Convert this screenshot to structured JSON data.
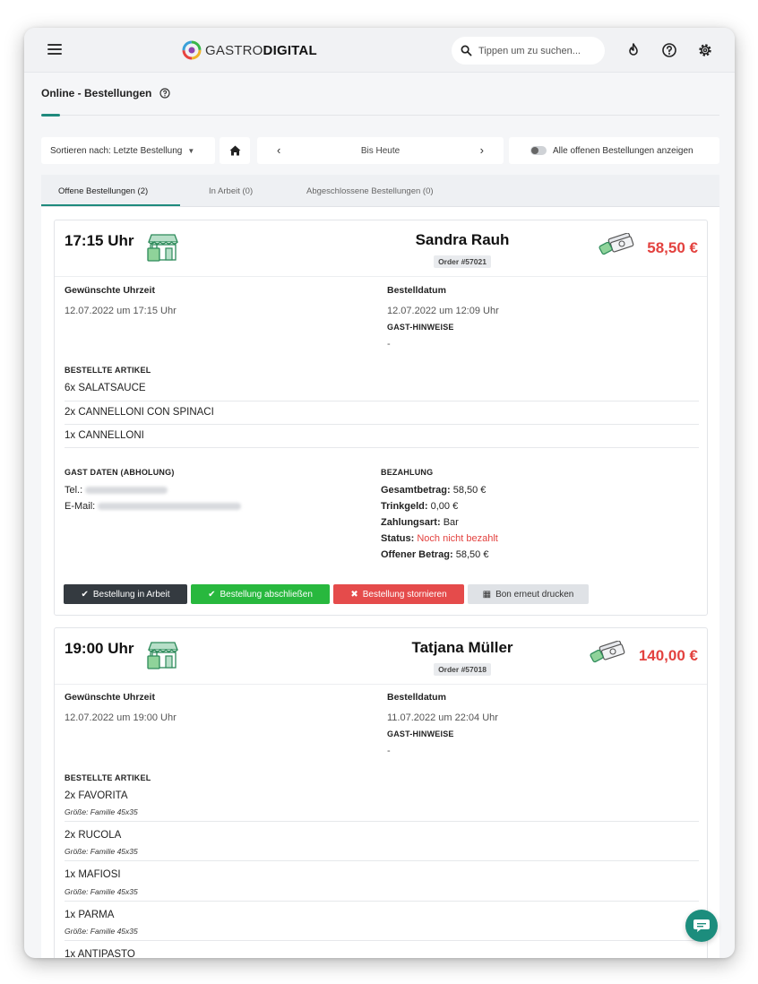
{
  "brand": {
    "name_light": "GASTRO",
    "name_bold": "DIGITAL"
  },
  "search": {
    "placeholder": "Tippen um zu suchen..."
  },
  "page": {
    "title": "Online - Bestellungen"
  },
  "filters": {
    "sort_label": "Sortieren nach: Letzte Bestellung",
    "date_label": "Bis Heute",
    "toggle_label": "Alle offenen Bestellungen anzeigen"
  },
  "tabs": [
    {
      "label": "Offene Bestellungen (2)",
      "active": true
    },
    {
      "label": "In Arbeit (0)",
      "active": false
    },
    {
      "label": "Abgeschlossene Bestellungen (0)",
      "active": false
    }
  ],
  "labels": {
    "wish_time": "Gewünschte Uhrzeit",
    "order_date": "Bestelldatum",
    "guest_notes": "GAST-HINWEISE",
    "ordered_items": "BESTELLTE ARTIKEL",
    "guest_data": "GAST DATEN (ABHOLUNG)",
    "payment": "BEZAHLUNG",
    "tel": "Tel.:",
    "email": "E-Mail:",
    "total": "Gesamtbetrag:",
    "tip": "Trinkgeld:",
    "pay_type": "Zahlungsart:",
    "status": "Status:",
    "open_amount": "Offener Betrag:"
  },
  "actions": {
    "in_progress": "Bestellung in Arbeit",
    "complete": "Bestellung abschließen",
    "cancel": "Bestellung stornieren",
    "reprint": "Bon erneut drucken"
  },
  "orders": [
    {
      "time": "17:15 Uhr",
      "customer": "Sandra Rauh",
      "order_no": "Order #57021",
      "price": "58,50 €",
      "wish_time": "12.07.2022 um 17:15 Uhr",
      "order_date": "12.07.2022 um 12:09 Uhr",
      "notes": "-",
      "items": [
        {
          "name": "6x SALATSAUCE"
        },
        {
          "name": "2x CANNELLONI CON SPINACI"
        },
        {
          "name": "1x CANNELLONI"
        }
      ],
      "payment": {
        "total": "58,50 €",
        "tip": "0,00 €",
        "type": "Bar",
        "status": "Noch nicht bezahlt",
        "open": "58,50 €"
      }
    },
    {
      "time": "19:00 Uhr",
      "customer": "Tatjana Müller",
      "order_no": "Order #57018",
      "price": "140,00 €",
      "wish_time": "12.07.2022 um 19:00 Uhr",
      "order_date": "11.07.2022 um 22:04 Uhr",
      "notes": "-",
      "items": [
        {
          "name": "2x FAVORITA",
          "size": "Größe: Familie 45x35"
        },
        {
          "name": "2x RUCOLA",
          "size": "Größe: Familie 45x35"
        },
        {
          "name": "1x MAFIOSI",
          "size": "Größe: Familie 45x35"
        },
        {
          "name": "1x PARMA",
          "size": "Größe: Familie 45x35"
        },
        {
          "name": "1x ANTIPASTO"
        }
      ]
    }
  ],
  "colors": {
    "accent": "#1f8a7d",
    "price_red": "#e3423f",
    "btn_dark": "#343a40",
    "btn_green": "#28b83e",
    "btn_red": "#e54b4b"
  }
}
